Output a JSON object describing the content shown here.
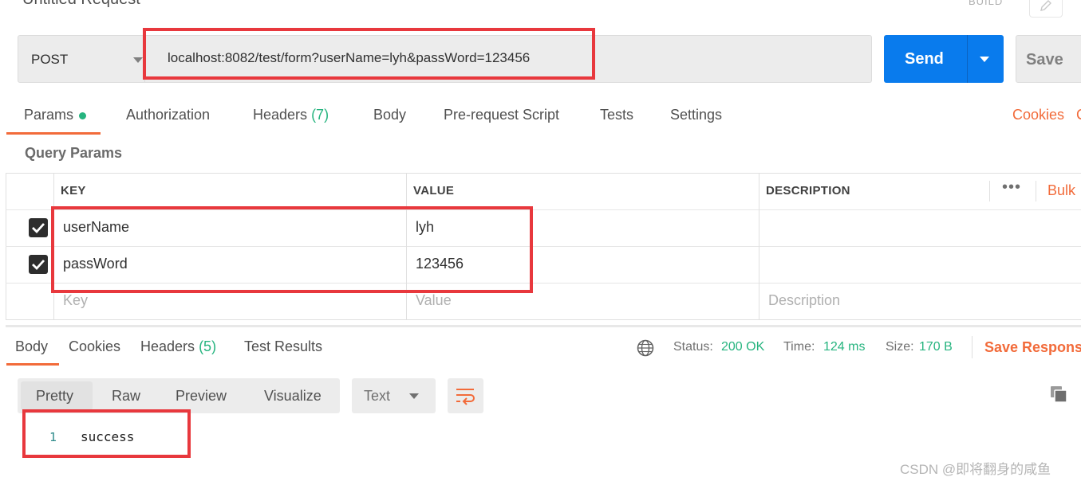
{
  "header": {
    "title": "Untitled Request",
    "build_label": "BUILD",
    "edit_icon": "pencil-icon"
  },
  "request": {
    "method": "POST",
    "url": "localhost:8082/test/form?userName=lyh&passWord=123456",
    "send_label": "Send",
    "save_label": "Save"
  },
  "tabs": [
    {
      "label": "Params",
      "active": true
    },
    {
      "label": "Authorization"
    },
    {
      "label": "Headers",
      "count": "(7)"
    },
    {
      "label": "Body"
    },
    {
      "label": "Pre-request Script"
    },
    {
      "label": "Tests"
    },
    {
      "label": "Settings"
    }
  ],
  "cookies_link": "Cookies",
  "cut_link": "C",
  "query_params": {
    "title": "Query Params",
    "columns": [
      "KEY",
      "VALUE",
      "DESCRIPTION"
    ],
    "more_label": "•••",
    "bulk_label": "Bulk",
    "rows": [
      {
        "checked": true,
        "key": "userName",
        "value": "lyh",
        "description": ""
      },
      {
        "checked": true,
        "key": "passWord",
        "value": "123456",
        "description": ""
      }
    ],
    "placeholder": {
      "key": "Key",
      "value": "Value",
      "description": "Description"
    }
  },
  "response": {
    "tabs": [
      {
        "label": "Body",
        "active": true
      },
      {
        "label": "Cookies"
      },
      {
        "label": "Headers",
        "count": "(5)"
      },
      {
        "label": "Test Results"
      }
    ],
    "status_label": "Status:",
    "status_value": "200 OK",
    "time_label": "Time:",
    "time_value": "124 ms",
    "size_label": "Size:",
    "size_value": "170 B",
    "save_response_label": "Save Response",
    "view_tabs": [
      "Pretty",
      "Raw",
      "Preview",
      "Visualize"
    ],
    "format": "Text",
    "code_lines": [
      {
        "no": "1",
        "text": "success"
      }
    ]
  },
  "colors": {
    "accent": "#f26b3a",
    "send": "#097bed",
    "success": "#26b47f",
    "annotation": "#e8383d"
  },
  "watermark": "CSDN @即将翻身的咸鱼"
}
